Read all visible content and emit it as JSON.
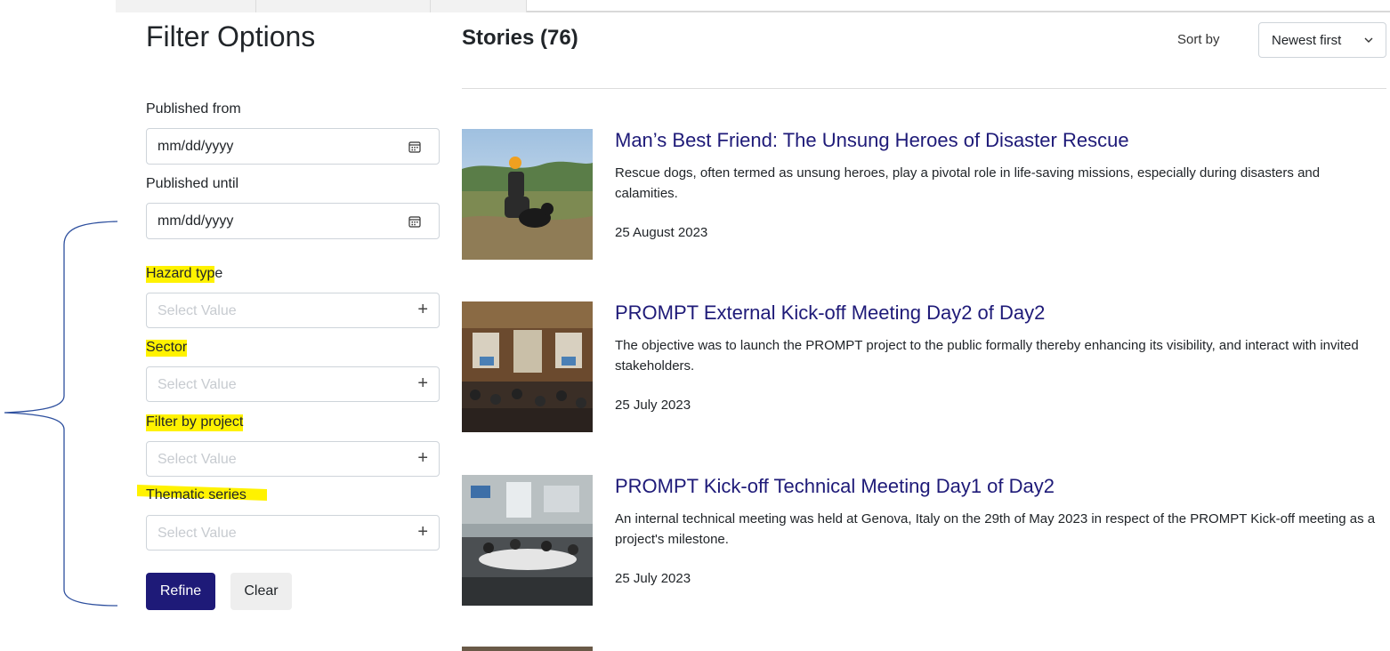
{
  "filters": {
    "title": "Filter Options",
    "published_from_label": "Published from",
    "published_from_value": "mm/dd/yyyy",
    "published_until_label": "Published until",
    "published_until_value": "mm/dd/yyyy",
    "hazard_label_hl": "Hazard typ",
    "hazard_label_rest": "e",
    "hazard_placeholder": "Select Value",
    "sector_label": "Sector",
    "sector_placeholder": "Select Value",
    "project_label": "Filter by project",
    "project_placeholder": "Select Value",
    "thematic_label": "Thematic series",
    "thematic_placeholder": "Select Value",
    "plus": "+",
    "refine_label": "Refine",
    "clear_label": "Clear"
  },
  "stories": {
    "title": "Stories (76)",
    "sort_label": "Sort by",
    "sort_value": "Newest first",
    "items": [
      {
        "title": "Man’s Best Friend: The Unsung Heroes of Disaster Rescue",
        "excerpt": "Rescue dogs, often termed as unsung heroes, play a pivotal role in life-saving missions, especially during disasters and calamities.",
        "date": "25 August 2023"
      },
      {
        "title": "PROMPT External Kick-off Meeting Day2 of Day2",
        "excerpt": "The objective was to launch the PROMPT project to the public formally thereby enhancing its visibility, and interact with invited stakeholders.",
        "date": "25 July 2023"
      },
      {
        "title": "PROMPT Kick-off Technical Meeting Day1 of Day2",
        "excerpt": "An internal technical meeting was held at Genova, Italy on the 29th of May 2023 in respect of the PROMPT Kick-off meeting as a project's milestone.",
        "date": "25 July 2023"
      }
    ]
  },
  "colors": {
    "accent": "#1e1a78",
    "highlight": "#fff200",
    "annotation": "#2d4f9e"
  }
}
